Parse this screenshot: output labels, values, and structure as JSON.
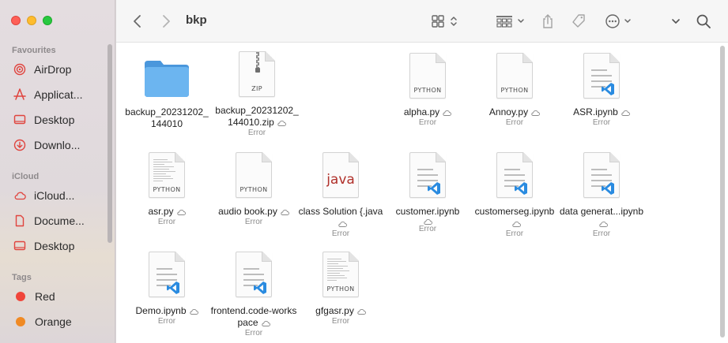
{
  "window": {
    "title": "bkp"
  },
  "sidebar": {
    "favourites_label": "Favourites",
    "favourites": [
      {
        "label": "AirDrop",
        "icon": "airdrop-icon"
      },
      {
        "label": "Applicat...",
        "icon": "applications-icon"
      },
      {
        "label": "Desktop",
        "icon": "desktop-icon"
      },
      {
        "label": "Downlo...",
        "icon": "downloads-icon"
      }
    ],
    "icloud_label": "iCloud",
    "icloud": [
      {
        "label": "iCloud...",
        "icon": "icloud-drive-icon"
      },
      {
        "label": "Docume...",
        "icon": "documents-icon"
      },
      {
        "label": "Desktop",
        "icon": "desktop-icon"
      }
    ],
    "tags_label": "Tags",
    "tags": [
      {
        "label": "Red",
        "color": "#f0453a"
      },
      {
        "label": "Orange",
        "color": "#f08a24"
      }
    ]
  },
  "colors": {
    "accent": "#e0443e",
    "folder": "#5aa8e8",
    "vscode": "#2a8be0"
  },
  "files": [
    {
      "name": "backup_20231202_144010",
      "type": "folder",
      "status": ""
    },
    {
      "name": "backup_20231202_144010.zip",
      "type": "zip",
      "tag": "ZIP",
      "status": "Error"
    },
    {
      "name": "alpha.py",
      "type": "python",
      "tag": "PYTHON",
      "status": "Error"
    },
    {
      "name": "Annoy.py",
      "type": "python",
      "tag": "PYTHON",
      "status": "Error"
    },
    {
      "name": "ASR.ipynb",
      "type": "ipynb",
      "status": "Error"
    },
    {
      "name": "asr.py",
      "type": "python-code",
      "tag": "PYTHON",
      "status": "Error"
    },
    {
      "name": "audio book.py",
      "type": "python",
      "tag": "PYTHON",
      "status": "Error"
    },
    {
      "name": "class Solution {.java",
      "type": "java",
      "tag": "java",
      "status": "Error"
    },
    {
      "name": "customer.ipynb",
      "type": "ipynb",
      "status": "Error"
    },
    {
      "name": "customerseg.ipynb",
      "type": "ipynb",
      "status": "Error"
    },
    {
      "name": "data generat...ipynb",
      "type": "ipynb",
      "status": "Error"
    },
    {
      "name": "Demo.ipynb",
      "type": "ipynb",
      "status": "Error"
    },
    {
      "name": "frontend.code-workspace",
      "type": "ipynb",
      "status": "Error"
    },
    {
      "name": "gfgasr.py",
      "type": "python-code",
      "tag": "PYTHON",
      "status": "Error"
    }
  ]
}
